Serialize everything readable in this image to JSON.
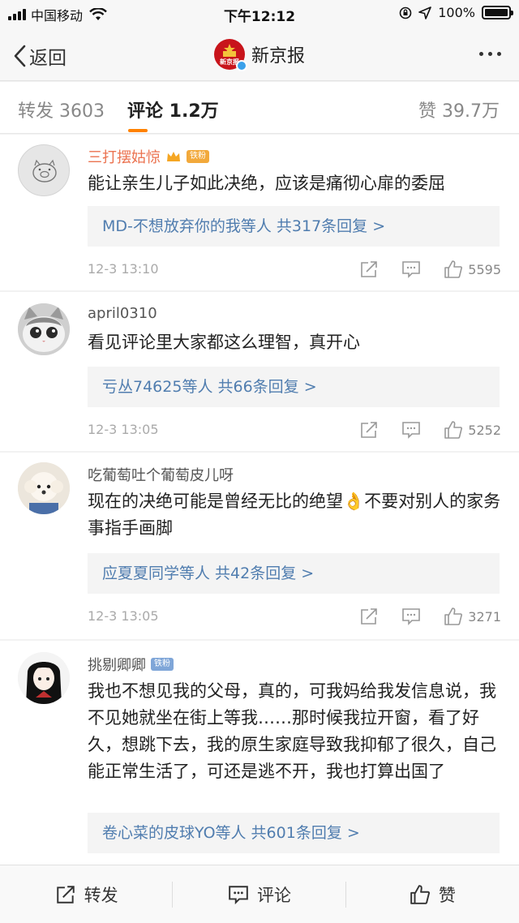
{
  "status_bar": {
    "carrier": "中国移动",
    "time": "下午12:12",
    "battery": "100%",
    "battery_level": 1.0
  },
  "nav": {
    "back_label": "返回",
    "title": "新京报",
    "avatar_text": "新京报"
  },
  "tabs": [
    {
      "label": "转发 3603"
    },
    {
      "label": "评论 1.2万"
    },
    {
      "label": "赞 39.7万"
    }
  ],
  "comments": [
    {
      "username": "三打摆姑惊",
      "badge": "铁粉",
      "text": "能让亲生儿子如此决绝，应该是痛彻心扉的委屈",
      "replies": "MD-不想放弃你的我等人  共317条回复 >",
      "time": "12-3 13:10",
      "likes": "5595"
    },
    {
      "username": "april0310",
      "badge": "",
      "text": "看见评论里大家都这么理智，真开心",
      "replies": "亏丛74625等人  共66条回复 >",
      "time": "12-3 13:05",
      "likes": "5252"
    },
    {
      "username": "吃葡萄吐个葡萄皮儿呀",
      "badge": "",
      "text": "现在的决绝可能是曾经无比的绝望👌不要对别人的家务事指手画脚",
      "replies": "应夏夏同学等人  共42条回复 >",
      "time": "12-3 13:05",
      "likes": "3271"
    },
    {
      "username": "挑剔卿卿",
      "badge": "铁粉",
      "text": "我也不想见我的父母，真的，可我妈给我发信息说，我不见她就坐在街上等我……那时候我拉开窗，看了好久，想跳下去，我的原生家庭导致我抑郁了很久，自己能正常生活了，可还是逃不开，我也打算出国了",
      "replies": "卷心菜的皮球YO等人  共601条回复 >"
    }
  ],
  "bottom_bar": {
    "repost": "转发",
    "comment": "评论",
    "like": "赞"
  },
  "icons": {
    "back": "chevron-left-icon",
    "more": "more-dots-icon",
    "share": "share-icon",
    "comment": "comment-icon",
    "like": "thumbs-up-icon"
  },
  "colors": {
    "accent": "#ff8200",
    "link": "#507daf",
    "username_highlight": "#eb7350"
  }
}
